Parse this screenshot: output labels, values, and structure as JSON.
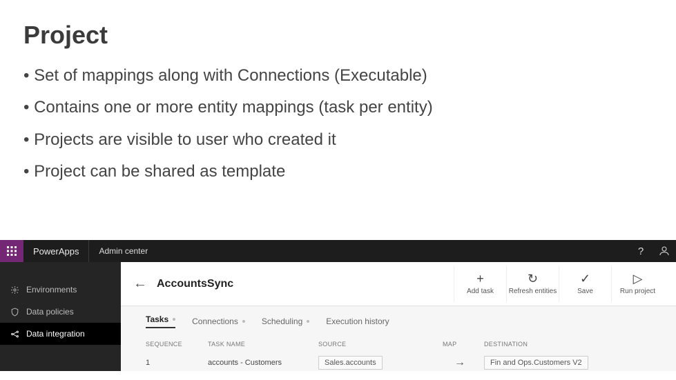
{
  "slide": {
    "title": "Project",
    "bullets": [
      "Set of mappings along with Connections (Executable)",
      "Contains one or more entity mappings (task per entity)",
      "Projects are visible to user who created it",
      "Project can be shared as template"
    ]
  },
  "app": {
    "brand": "PowerApps",
    "section": "Admin center",
    "help_label": "?",
    "sidebar": {
      "items": [
        {
          "label": "Environments"
        },
        {
          "label": "Data policies"
        },
        {
          "label": "Data integration"
        }
      ]
    },
    "header": {
      "back": "←",
      "title": "AccountsSync",
      "actions": [
        {
          "icon": "+",
          "label": "Add task"
        },
        {
          "icon": "↻",
          "label": "Refresh entities"
        },
        {
          "icon": "✓",
          "label": "Save"
        },
        {
          "icon": "▷",
          "label": "Run project"
        }
      ]
    },
    "tabs": [
      {
        "label": "Tasks",
        "active": true
      },
      {
        "label": "Connections"
      },
      {
        "label": "Scheduling"
      },
      {
        "label": "Execution history"
      }
    ],
    "table": {
      "columns": [
        "SEQUENCE",
        "TASK NAME",
        "SOURCE",
        "MAP",
        "DESTINATION"
      ],
      "rows": [
        {
          "sequence": "1",
          "task_name": "accounts - Customers",
          "source": "Sales.accounts",
          "map": "→",
          "destination": "Fin and Ops.Customers V2"
        }
      ]
    }
  }
}
